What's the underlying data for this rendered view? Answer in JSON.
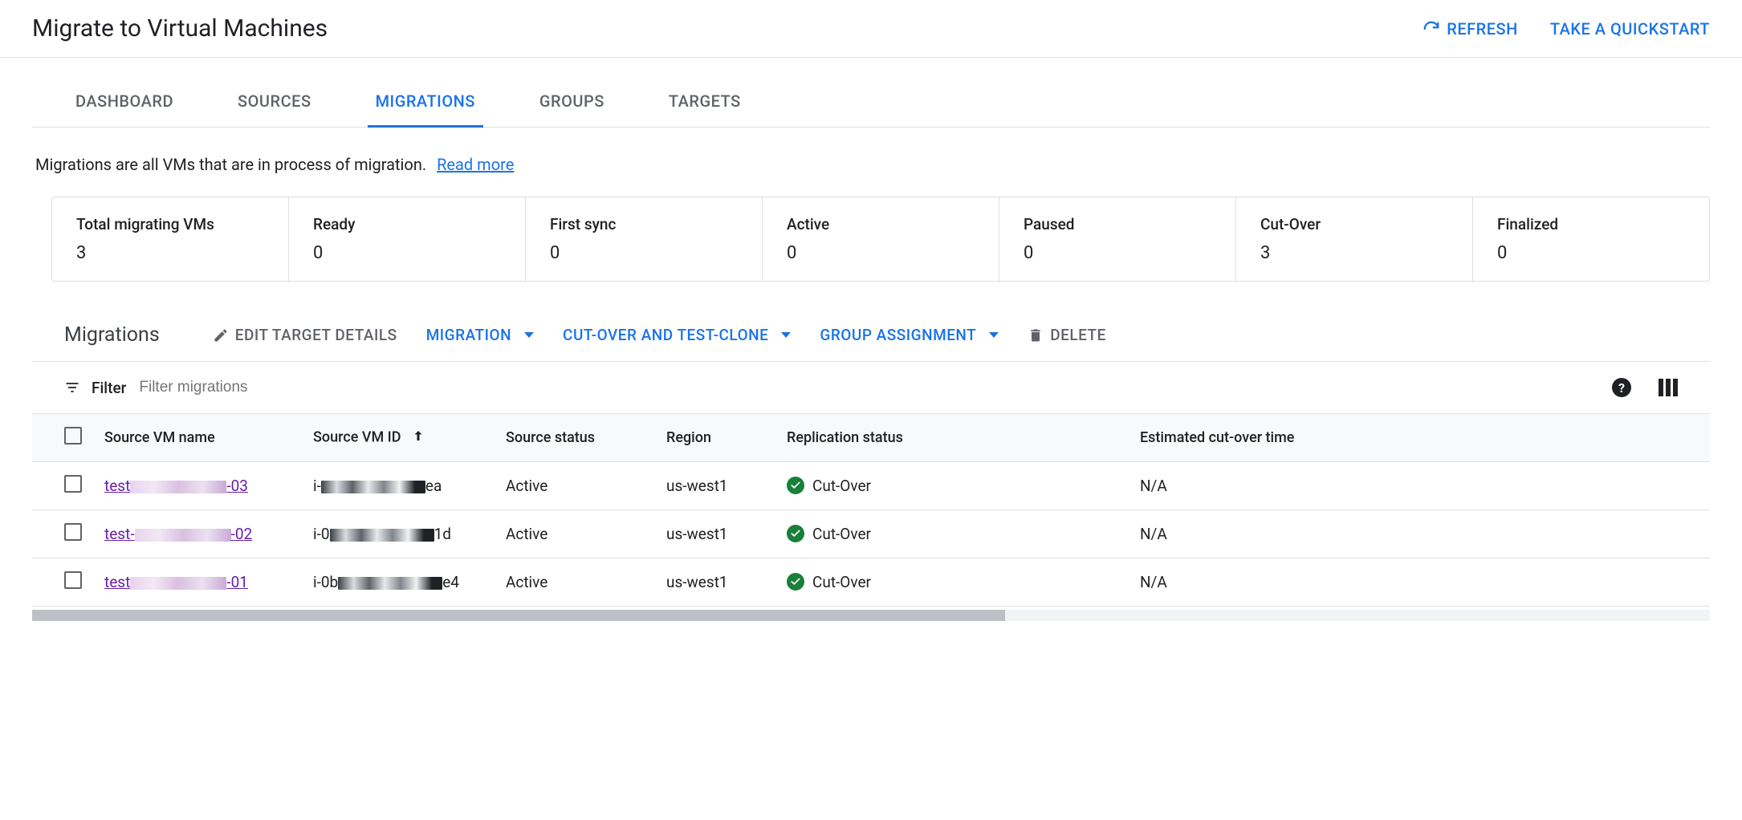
{
  "header": {
    "title": "Migrate to Virtual Machines",
    "refresh": "REFRESH",
    "quickstart": "TAKE A QUICKSTART"
  },
  "tabs": [
    "DASHBOARD",
    "SOURCES",
    "MIGRATIONS",
    "GROUPS",
    "TARGETS"
  ],
  "activeTab": "MIGRATIONS",
  "description": "Migrations are all VMs that are in process of migration.",
  "readMore": "Read more",
  "stats": [
    {
      "label": "Total migrating VMs",
      "value": "3"
    },
    {
      "label": "Ready",
      "value": "0"
    },
    {
      "label": "First sync",
      "value": "0"
    },
    {
      "label": "Active",
      "value": "0"
    },
    {
      "label": "Paused",
      "value": "0"
    },
    {
      "label": "Cut-Over",
      "value": "3"
    },
    {
      "label": "Finalized",
      "value": "0"
    }
  ],
  "section": {
    "title": "Migrations",
    "editTarget": "EDIT TARGET DETAILS",
    "migration": "MIGRATION",
    "cutover": "CUT-OVER AND TEST-CLONE",
    "group": "GROUP ASSIGNMENT",
    "delete": "DELETE"
  },
  "filter": {
    "label": "Filter",
    "placeholder": "Filter migrations"
  },
  "columns": {
    "name": "Source VM name",
    "id": "Source VM ID",
    "srcStatus": "Source status",
    "region": "Region",
    "replStatus": "Replication status",
    "eta": "Estimated cut-over time"
  },
  "rows": [
    {
      "namePrefix": "test",
      "nameSuffix": "-03",
      "idPrefix": "i-",
      "idSuffix": "ea",
      "srcStatus": "Active",
      "region": "us-west1",
      "replStatus": "Cut-Over",
      "eta": "N/A"
    },
    {
      "namePrefix": "test-",
      "nameSuffix": "-02",
      "idPrefix": "i-0",
      "idSuffix": "1d",
      "srcStatus": "Active",
      "region": "us-west1",
      "replStatus": "Cut-Over",
      "eta": "N/A"
    },
    {
      "namePrefix": "test",
      "nameSuffix": "-01",
      "idPrefix": "i-0b",
      "idSuffix": "e4",
      "srcStatus": "Active",
      "region": "us-west1",
      "replStatus": "Cut-Over",
      "eta": "N/A"
    }
  ]
}
